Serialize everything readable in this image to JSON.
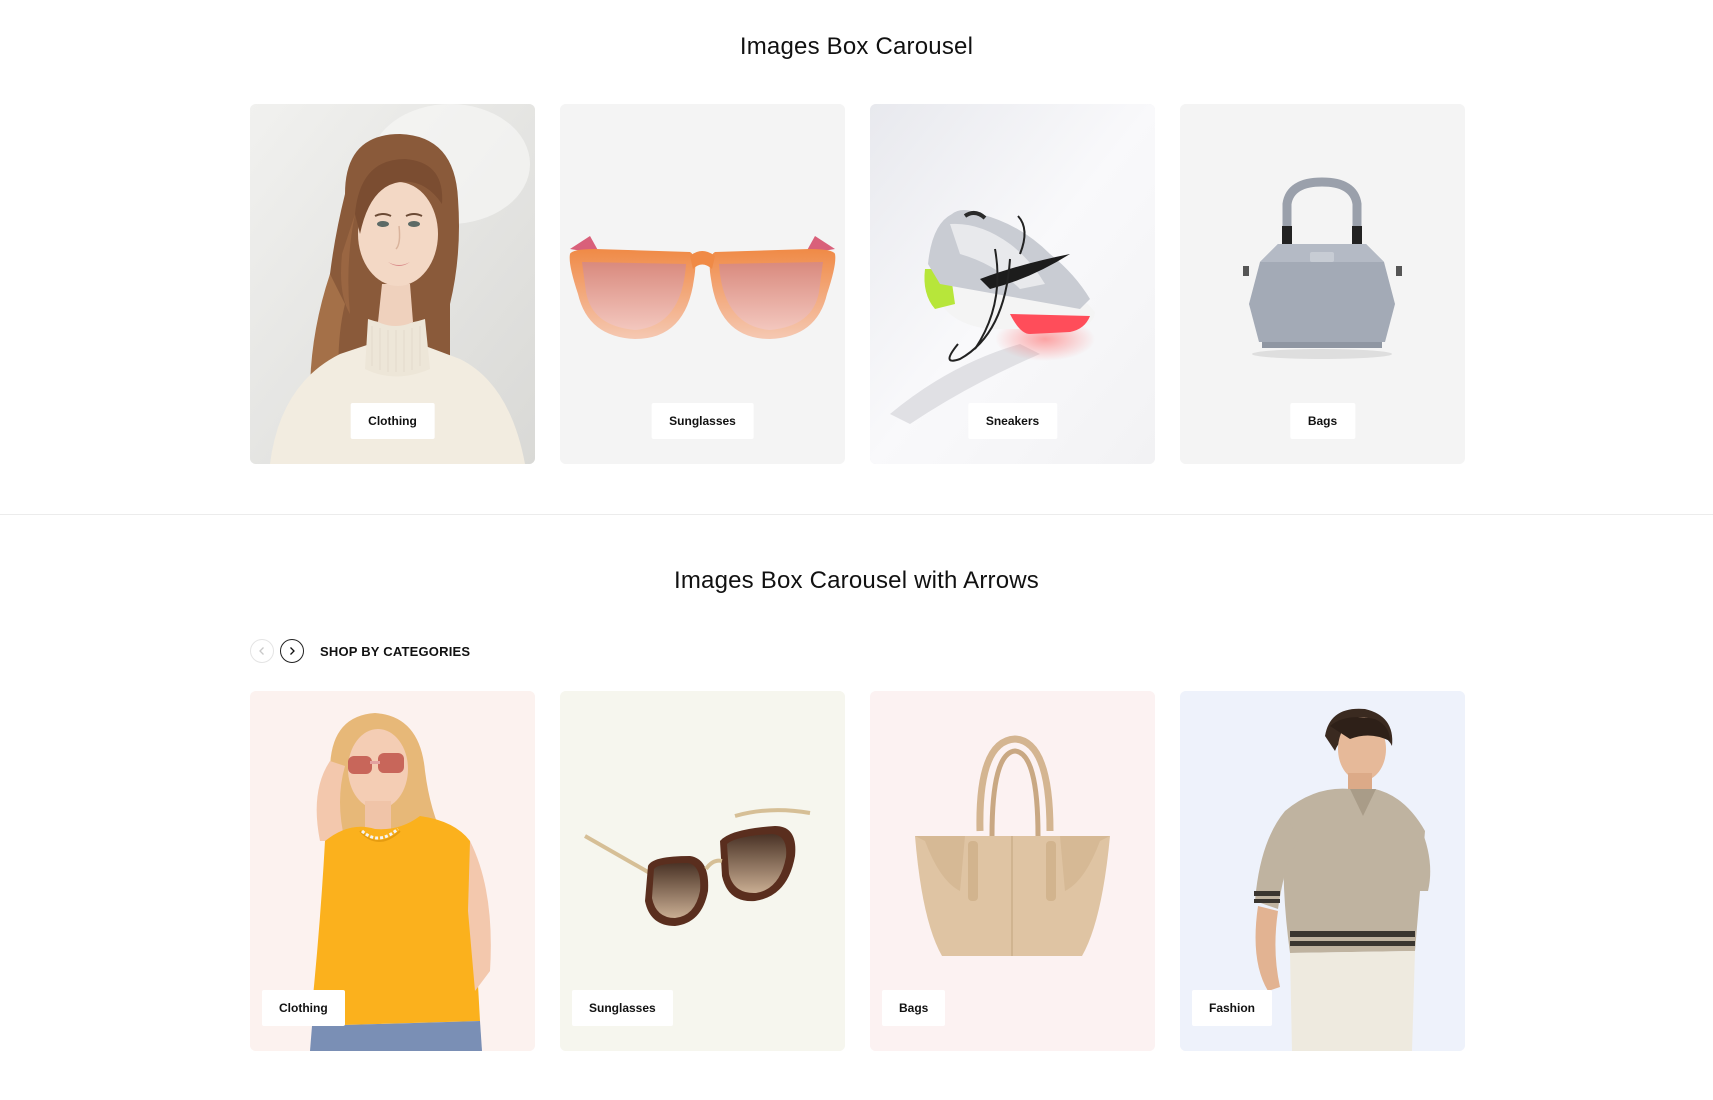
{
  "section_1": {
    "title": "Images Box Carousel",
    "cards": [
      {
        "label": "Clothing",
        "background": "#e9e9e7"
      },
      {
        "label": "Sunglasses",
        "background": "#f4f4f4"
      },
      {
        "label": "Sneakers",
        "background": "#eeeef0"
      },
      {
        "label": "Bags",
        "background": "#f4f4f4"
      }
    ]
  },
  "section_2": {
    "title": "Images Box Carousel with Arrows",
    "nav_title": "SHOP BY CATEGORIES",
    "prev_icon": "chevron-left-icon",
    "next_icon": "chevron-right-icon",
    "cards": [
      {
        "label": "Clothing",
        "background": "#fcf2ef"
      },
      {
        "label": "Sunglasses",
        "background": "#f6f6ee"
      },
      {
        "label": "Bags",
        "background": "#fcf2f2"
      },
      {
        "label": "Fashion",
        "background": "#eef2fb"
      }
    ]
  }
}
